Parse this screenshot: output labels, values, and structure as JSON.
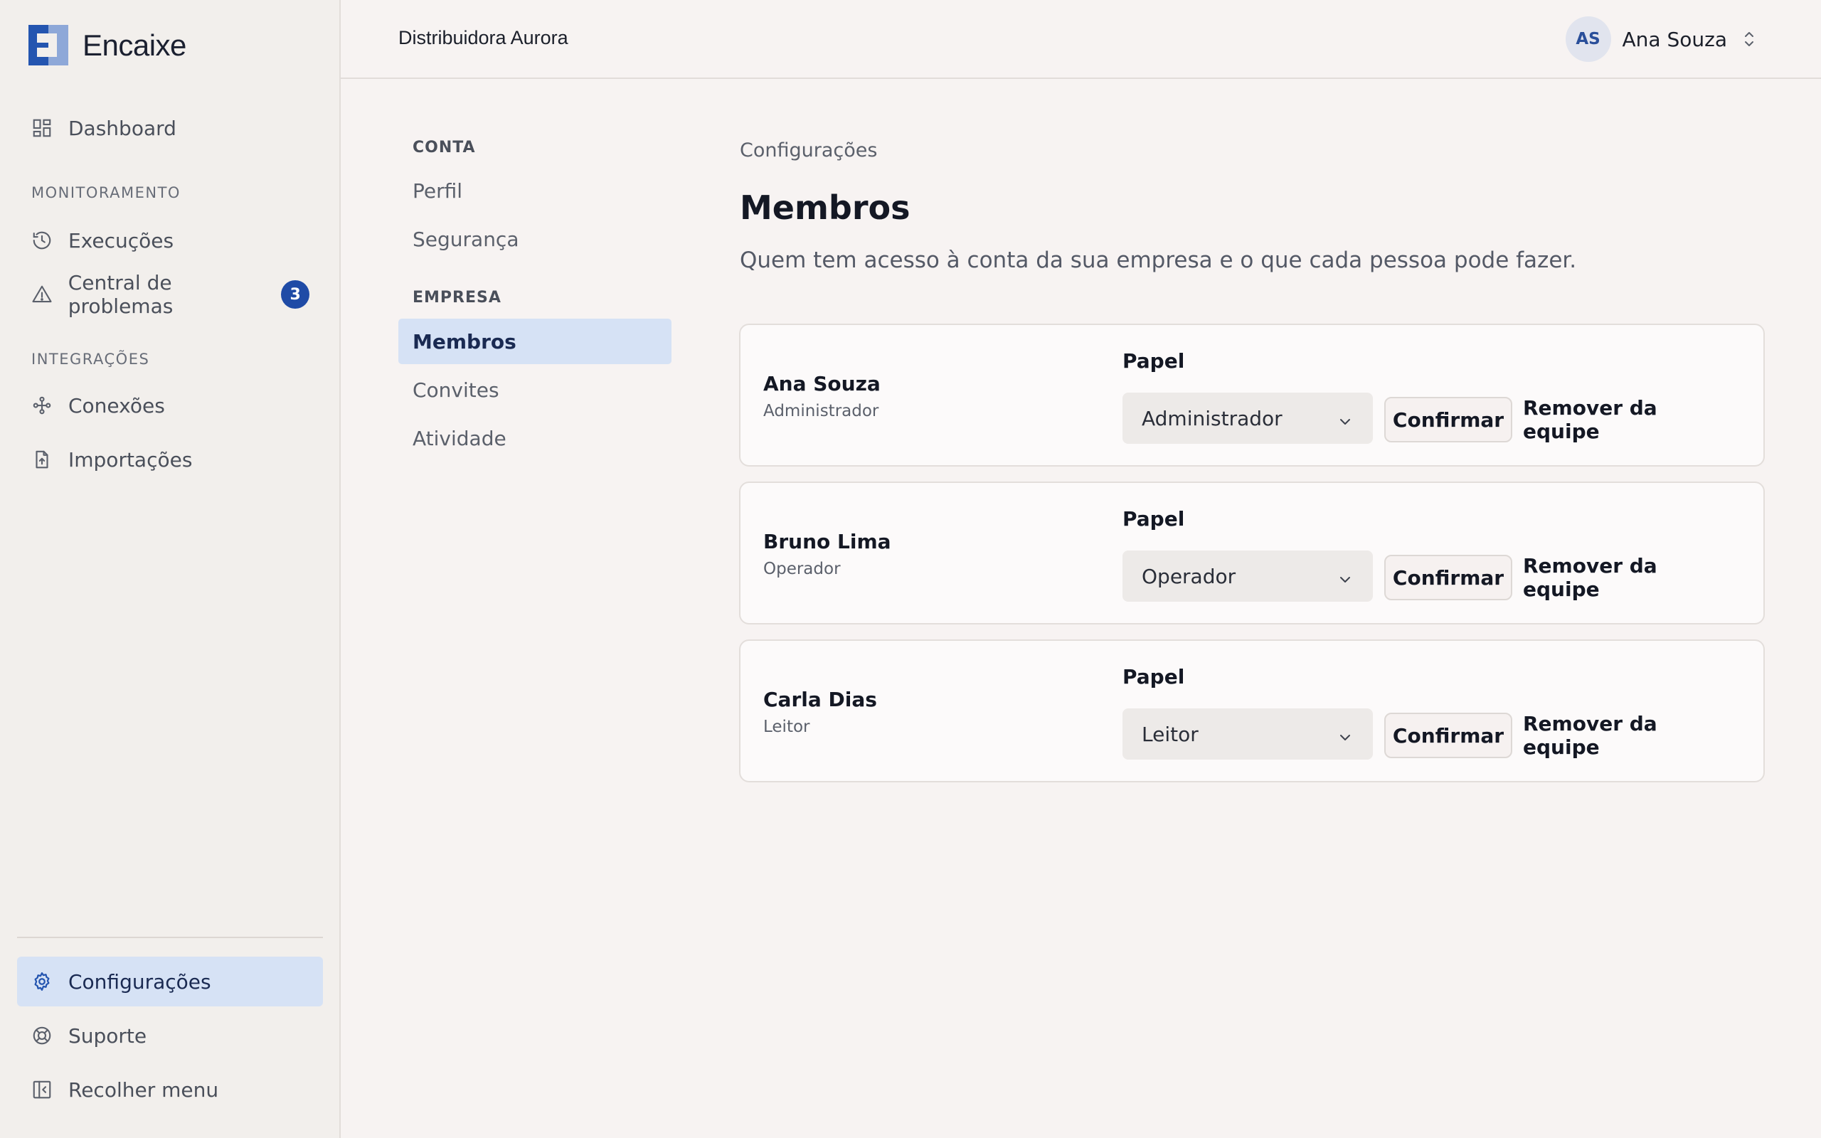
{
  "brand": {
    "name": "Encaixe",
    "colors": {
      "primary": "#2455b0",
      "secondary": "#8ea8d8"
    }
  },
  "sidebar": {
    "items_top": [
      {
        "label": "Dashboard",
        "icon": "grid-icon"
      }
    ],
    "sections": [
      {
        "title": "MONITORAMENTO",
        "items": [
          {
            "label": "Execuções",
            "icon": "history-icon"
          },
          {
            "label": "Central de problemas",
            "icon": "alert-triangle-icon",
            "badge": "3"
          }
        ]
      },
      {
        "title": "INTEGRAÇÕES",
        "items": [
          {
            "label": "Conexões",
            "icon": "connections-icon"
          },
          {
            "label": "Importações",
            "icon": "file-upload-icon"
          }
        ]
      }
    ],
    "items_bottom": [
      {
        "label": "Configurações",
        "icon": "gear-icon",
        "active": true
      },
      {
        "label": "Suporte",
        "icon": "lifebuoy-icon"
      },
      {
        "label": "Recolher menu",
        "icon": "collapse-sidebar-icon"
      }
    ]
  },
  "topbar": {
    "org_name": "Distribuidora Aurora",
    "user": {
      "initials": "AS",
      "name": "Ana Souza"
    }
  },
  "subnav": {
    "sections": [
      {
        "title": "CONTA",
        "items": [
          "Perfil",
          "Segurança"
        ]
      },
      {
        "title": "EMPRESA",
        "items": [
          "Membros",
          "Convites",
          "Atividade"
        ]
      }
    ],
    "active": "Membros"
  },
  "main": {
    "breadcrumb": "Configurações",
    "title": "Membros",
    "subtitle": "Quem tem acesso à conta da sua empresa e o que cada pessoa pode fazer.",
    "field_label": "Papel",
    "confirm_label": "Confirmar",
    "remove_label": "Remover da equipe",
    "members": [
      {
        "name": "Ana Souza",
        "role": "Administrador",
        "selected_role": "Administrador"
      },
      {
        "name": "Bruno Lima",
        "role": "Operador",
        "selected_role": "Operador"
      },
      {
        "name": "Carla Dias",
        "role": "Leitor",
        "selected_role": "Leitor"
      }
    ]
  }
}
